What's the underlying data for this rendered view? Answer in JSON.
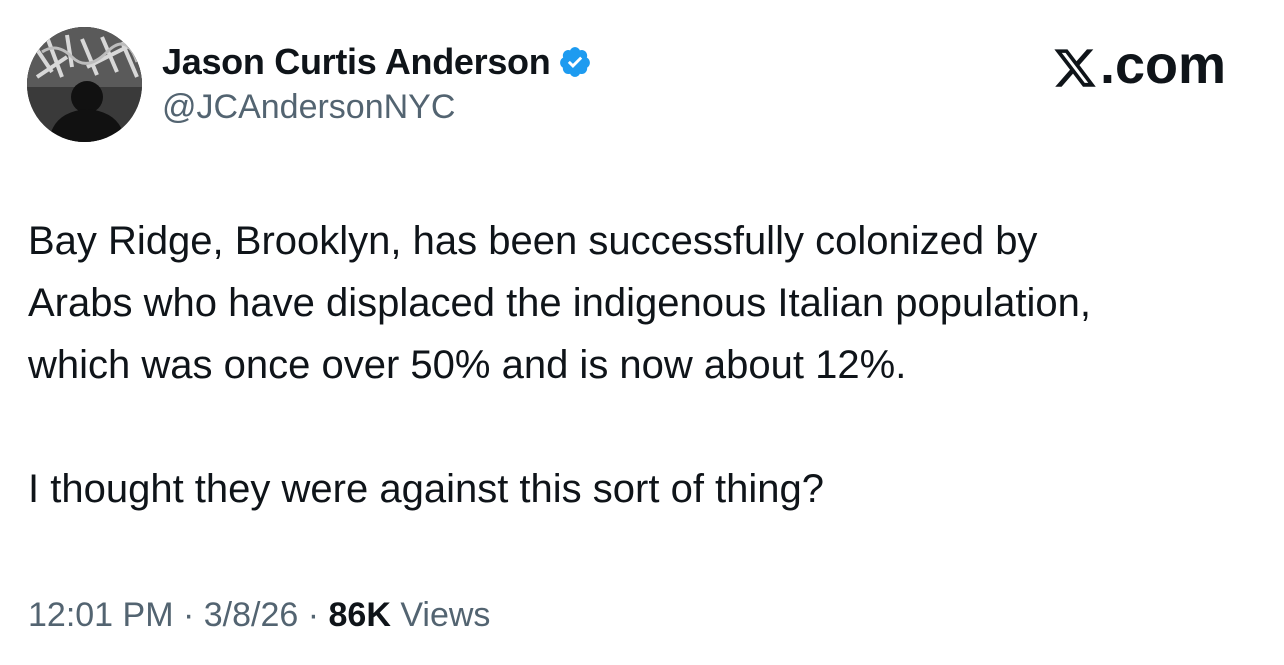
{
  "author": {
    "display_name": "Jason Curtis Anderson",
    "handle": "@JCAndersonNYC",
    "verified": true,
    "verified_color": "#1d9bf0"
  },
  "brand": {
    "logo_icon": "x-logo-icon",
    "suffix": ".com"
  },
  "tweet": {
    "paragraphs": [
      "Bay Ridge, Brooklyn, has been successfully colonized by\nArabs who have displaced the indigenous Italian population,\nwhich was once over 50% and is now about 12%.",
      "I thought they were against this sort of thing?"
    ]
  },
  "meta": {
    "time": "12:01 PM",
    "separator": " · ",
    "date": "3/8/26",
    "views_count": "86K",
    "views_label": "Views"
  },
  "colors": {
    "text_primary": "#0f1419",
    "text_secondary": "#536471"
  }
}
